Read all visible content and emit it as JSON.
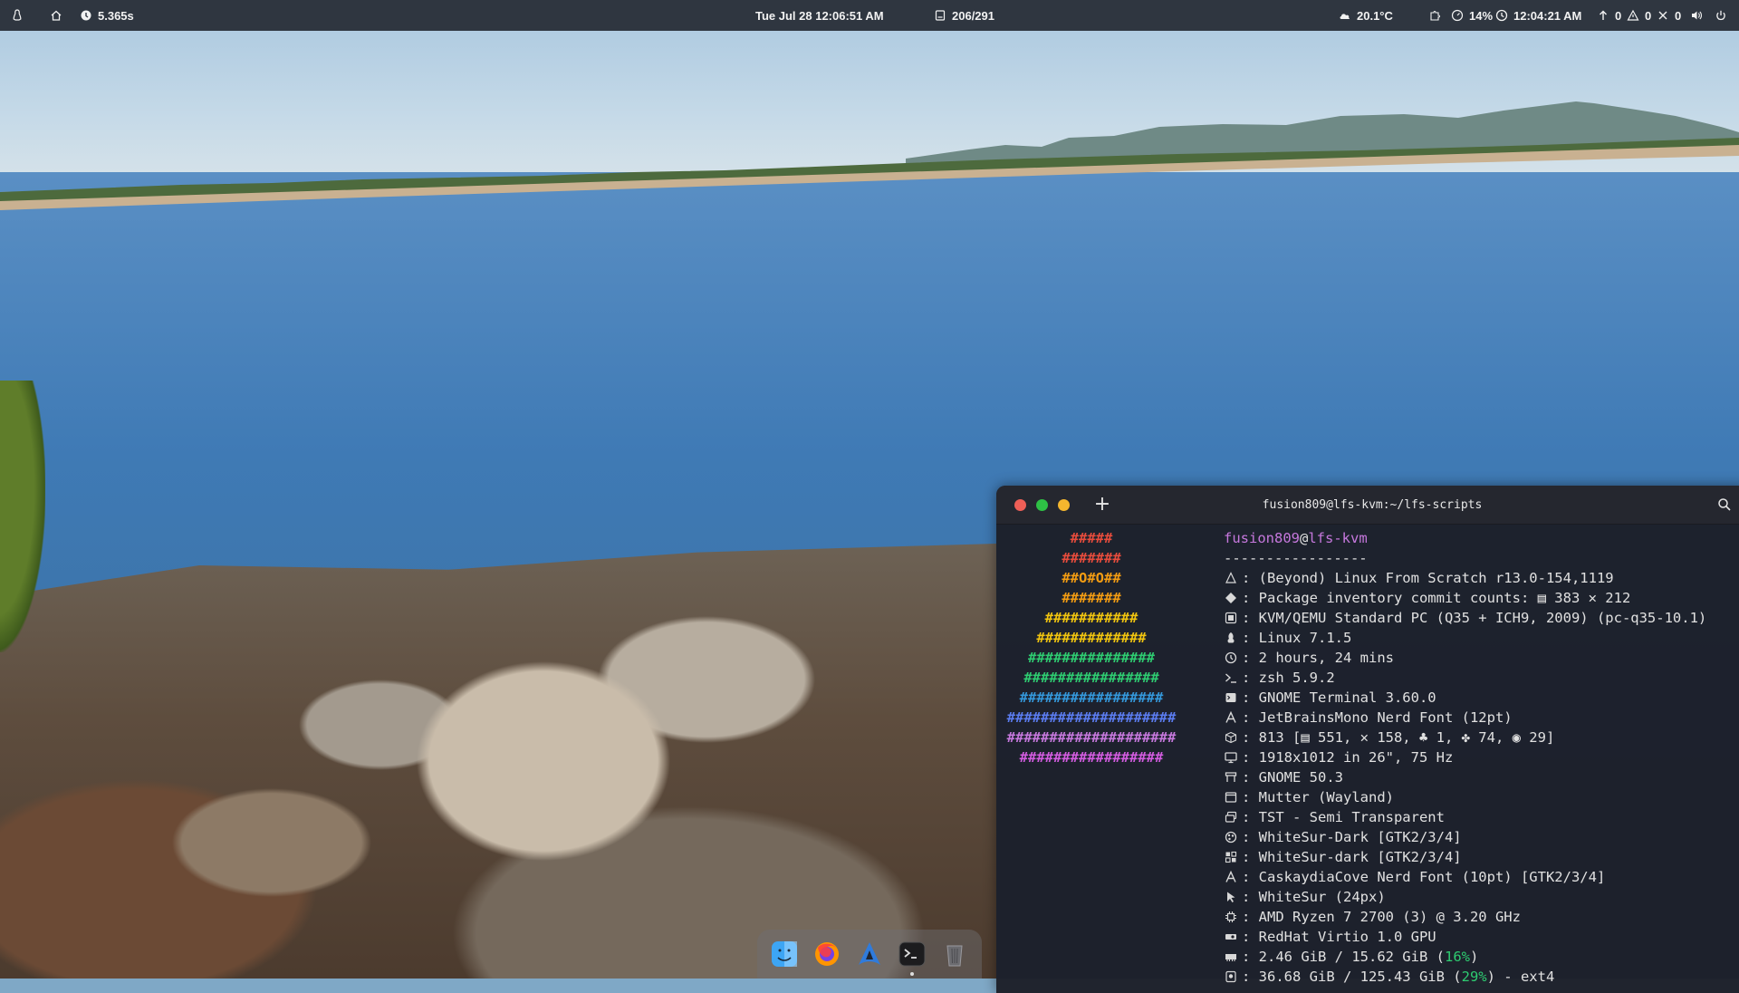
{
  "topbar": {
    "left": {
      "activities_icon": "tux-icon",
      "home_icon": "home-icon",
      "timer": "5.365s"
    },
    "center": {
      "datetime": "Tue Jul 28 12:06:51 AM",
      "counter": "206/291"
    },
    "right": {
      "weather": "20.1°C",
      "cpu": "14%",
      "clock": "12:04:21 AM",
      "up": "0",
      "warn": "0",
      "errors": "0"
    }
  },
  "terminal": {
    "title": "fusion809@lfs-kvm:~/lfs-scripts",
    "logo": [
      {
        "text": "#####",
        "color": "#e74c3c"
      },
      {
        "text": "#######",
        "color": "#e74c3c"
      },
      {
        "text": "##O#O##",
        "color": "#f39c12"
      },
      {
        "text": "#######",
        "color": "#f39c12"
      },
      {
        "text": "###########",
        "color": "#f1c40f"
      },
      {
        "text": "#############",
        "color": "#f1c40f"
      },
      {
        "text": "###############",
        "color": "#2ecc71"
      },
      {
        "text": "################",
        "color": "#2ecc71"
      },
      {
        "text": "#################",
        "color": "#3498db"
      },
      {
        "text": "####################",
        "color": "#5b7cf0"
      },
      {
        "text": "####################",
        "color": "#c678dd"
      },
      {
        "text": "#################",
        "color": "#d35ce0"
      }
    ],
    "user": "fusion809",
    "at": "@",
    "host": "lfs-kvm",
    "underline": "-----------------",
    "info": [
      {
        "icon": "lfs-icon",
        "value": "(Beyond) Linux From Scratch r13.0-154,1119"
      },
      {
        "icon": "git-icon",
        "value": "Package inventory commit counts: ▤ 383 ✕ 212"
      },
      {
        "icon": "host-icon",
        "value": "KVM/QEMU Standard PC (Q35 + ICH9, 2009) (pc-q35-10.1)"
      },
      {
        "icon": "kernel-icon",
        "value": "Linux 7.1.5"
      },
      {
        "icon": "uptime-icon",
        "value": "2 hours, 24 mins"
      },
      {
        "icon": "shell-icon",
        "value": "zsh 5.9.2"
      },
      {
        "icon": "terminal-icon",
        "value": "GNOME Terminal 3.60.0"
      },
      {
        "icon": "font-icon",
        "value": "JetBrainsMono Nerd Font (12pt)"
      },
      {
        "icon": "packages-icon",
        "value": "813 [▤ 551, ✕ 158, ♣ 1, ✤ 74, ◉ 29]"
      },
      {
        "icon": "display-icon",
        "value": "1918x1012 in 26\", 75 Hz"
      },
      {
        "icon": "de-icon",
        "value": "GNOME 50.3"
      },
      {
        "icon": "wm-icon",
        "value": "Mutter (Wayland)"
      },
      {
        "icon": "wm-theme-icon",
        "value": "TST - Semi Transparent"
      },
      {
        "icon": "theme-icon",
        "value": "WhiteSur-Dark [GTK2/3/4]"
      },
      {
        "icon": "icons-icon",
        "value": "WhiteSur-dark [GTK2/3/4]"
      },
      {
        "icon": "font-icon",
        "value": "CaskaydiaCove Nerd Font (10pt) [GTK2/3/4]"
      },
      {
        "icon": "cursor-icon",
        "value": "WhiteSur (24px)"
      },
      {
        "icon": "cpu-icon",
        "value": "AMD Ryzen 7 2700 (3) @ 3.20 GHz"
      },
      {
        "icon": "gpu-icon",
        "value": "RedHat Virtio 1.0 GPU"
      },
      {
        "icon": "memory-icon",
        "value": "2.46 GiB / 15.62 GiB (",
        "pct": "16%",
        "tail": ")"
      },
      {
        "icon": "disk-icon",
        "value": "36.68 GiB / 125.43 GiB (",
        "pct": "29%",
        "tail": ") - ext4"
      }
    ],
    "separator": ": "
  },
  "dock": [
    {
      "name": "finder-icon",
      "active": false
    },
    {
      "name": "firefox-icon",
      "active": false
    },
    {
      "name": "arch-launcher-icon",
      "active": false
    },
    {
      "name": "terminal-app-icon",
      "active": true
    },
    {
      "name": "trash-icon",
      "active": false
    }
  ]
}
